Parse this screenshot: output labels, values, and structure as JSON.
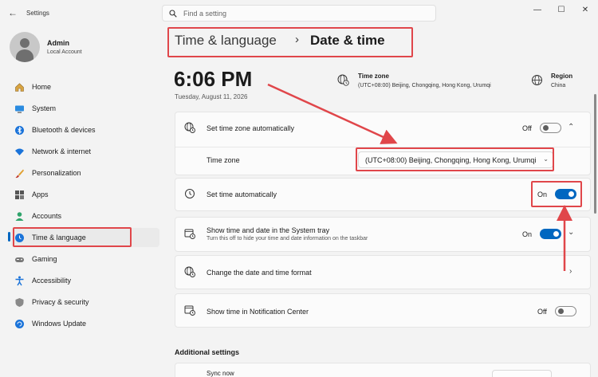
{
  "window": {
    "title": "Settings",
    "minimize": "—",
    "maximize": "☐",
    "close": "✕"
  },
  "search": {
    "placeholder": "Find a setting"
  },
  "account": {
    "name": "Admin",
    "type": "Local Account"
  },
  "sidebar": {
    "items": [
      {
        "label": "Home",
        "icon": "home-icon"
      },
      {
        "label": "System",
        "icon": "system-icon"
      },
      {
        "label": "Bluetooth & devices",
        "icon": "bluetooth-icon"
      },
      {
        "label": "Network & internet",
        "icon": "wifi-icon"
      },
      {
        "label": "Personalization",
        "icon": "brush-icon"
      },
      {
        "label": "Apps",
        "icon": "apps-icon"
      },
      {
        "label": "Accounts",
        "icon": "accounts-icon"
      },
      {
        "label": "Time & language",
        "icon": "time-language-icon",
        "active": true
      },
      {
        "label": "Gaming",
        "icon": "gamepad-icon"
      },
      {
        "label": "Accessibility",
        "icon": "accessibility-icon"
      },
      {
        "label": "Privacy & security",
        "icon": "shield-icon"
      },
      {
        "label": "Windows Update",
        "icon": "update-icon"
      }
    ]
  },
  "breadcrumb": {
    "parent": "Time & language",
    "separator": "›",
    "current": "Date & time"
  },
  "clock": {
    "time": "6:06 PM",
    "date": "Tuesday, August 11, 2026"
  },
  "timezone_info": {
    "title": "Time zone",
    "value": "(UTC+08:00) Beijing, Chongqing, Hong Kong, Urumqi"
  },
  "region_info": {
    "title": "Region",
    "value": "China"
  },
  "settings": {
    "set_tz_auto": {
      "label": "Set time zone automatically",
      "state": "Off"
    },
    "time_zone": {
      "label": "Time zone",
      "value": "(UTC+08:00) Beijing, Chongqing, Hong Kong, Urumqi"
    },
    "set_time_auto": {
      "label": "Set time automatically",
      "state": "On"
    },
    "show_tray": {
      "label": "Show time and date in the System tray",
      "sub": "Turn this off to hide your time and date information on the taskbar",
      "state": "On"
    },
    "date_format": {
      "label": "Change the date and time format"
    },
    "notif_center": {
      "label": "Show time in Notification Center",
      "state": "Off"
    }
  },
  "additional": {
    "title": "Additional settings",
    "sync_label": "Sync now"
  },
  "colors": {
    "accent": "#0067c0",
    "highlight": "#e0464a",
    "background": "#f3f3f3",
    "card": "#fbfbfb"
  }
}
